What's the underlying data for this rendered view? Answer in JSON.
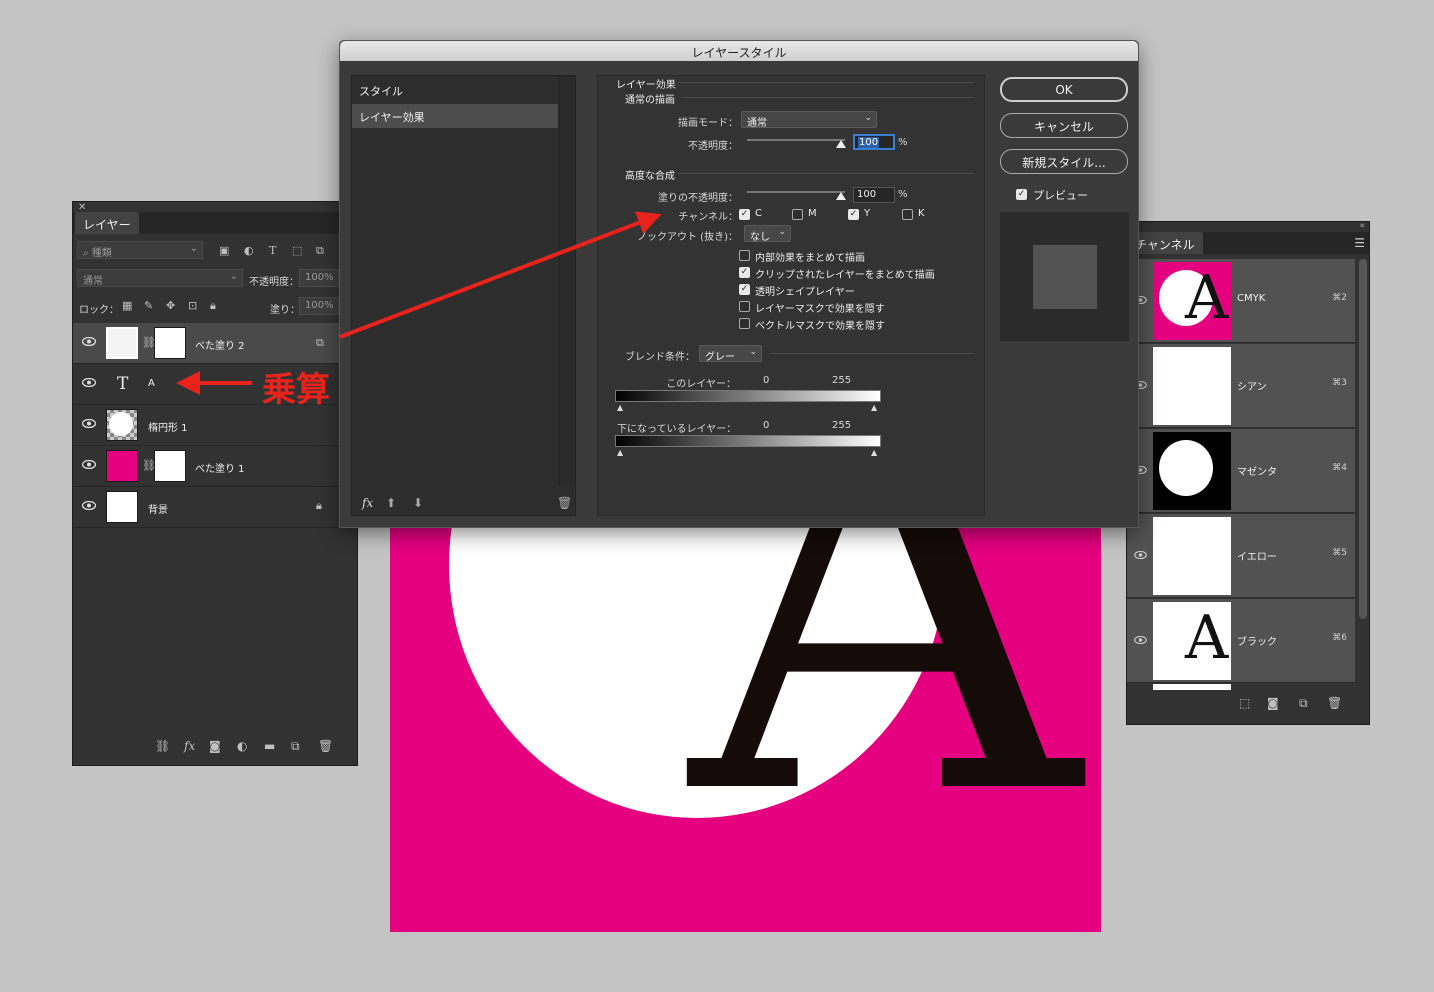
{
  "dialog": {
    "title": "レイヤースタイル",
    "styles_list": [
      "スタイル",
      "レイヤー効果"
    ],
    "section_title": "レイヤー効果",
    "normal_group": {
      "title": "通常の描画",
      "blend_mode_label": "描画モード：",
      "blend_mode_value": "通常",
      "opacity_label": "不透明度：",
      "opacity_value": "100",
      "percent": "%"
    },
    "advanced_group": {
      "title": "高度な合成",
      "fill_opacity_label": "塗りの不透明度：",
      "fill_opacity_value": "100",
      "percent": "%",
      "channels_label": "チャンネル：",
      "channels": [
        {
          "name": "C",
          "checked": true
        },
        {
          "name": "M",
          "checked": false
        },
        {
          "name": "Y",
          "checked": true
        },
        {
          "name": "K",
          "checked": false
        }
      ],
      "knockout_label": "ノックアウト (抜き)：",
      "knockout_value": "なし",
      "options": [
        {
          "label": "内部効果をまとめて描画",
          "checked": false
        },
        {
          "label": "クリップされたレイヤーをまとめて描画",
          "checked": true
        },
        {
          "label": "透明シェイプレイヤー",
          "checked": true
        },
        {
          "label": "レイヤーマスクで効果を隠す",
          "checked": false
        },
        {
          "label": "ベクトルマスクで効果を隠す",
          "checked": false
        }
      ]
    },
    "blend_if": {
      "label": "ブレンド条件：",
      "value": "グレー",
      "this_layer_label": "このレイヤー：",
      "this_layer_min": "0",
      "this_layer_max": "255",
      "underlying_label": "下になっているレイヤー：",
      "underlying_min": "0",
      "underlying_max": "255"
    },
    "buttons": {
      "ok": "OK",
      "cancel": "キャンセル",
      "new_style": "新規スタイル..."
    },
    "preview_label": "プレビュー",
    "preview_checked": true,
    "fx_label": "fx"
  },
  "layers_panel": {
    "tab": "レイヤー",
    "filter_placeholder": "種類",
    "blend_mode": "通常",
    "opacity_label": "不透明度：",
    "opacity_value": "100%",
    "lock_label": "ロック：",
    "fill_label": "塗り：",
    "fill_value": "100%",
    "layers": [
      {
        "name": "べた塗り 2",
        "selected": true
      },
      {
        "name": "A",
        "type": "text"
      },
      {
        "name": "楕円形 1"
      },
      {
        "name": "べた塗り 1"
      },
      {
        "name": "背景",
        "locked": true
      }
    ],
    "fx_label": "fx"
  },
  "channels_panel": {
    "tab": "チャンネル",
    "channels": [
      {
        "name": "CMYK",
        "shortcut": "⌘2"
      },
      {
        "name": "シアン",
        "shortcut": "⌘3"
      },
      {
        "name": "マゼンタ",
        "shortcut": "⌘4"
      },
      {
        "name": "イエロー",
        "shortcut": "⌘5"
      },
      {
        "name": "ブラック",
        "shortcut": "⌘6"
      }
    ]
  },
  "canvas": {
    "letter": "A",
    "background_color": "#e4007f"
  },
  "annotation": {
    "label": "乗算",
    "color": "#e8231b"
  },
  "thumb_letter": "A"
}
